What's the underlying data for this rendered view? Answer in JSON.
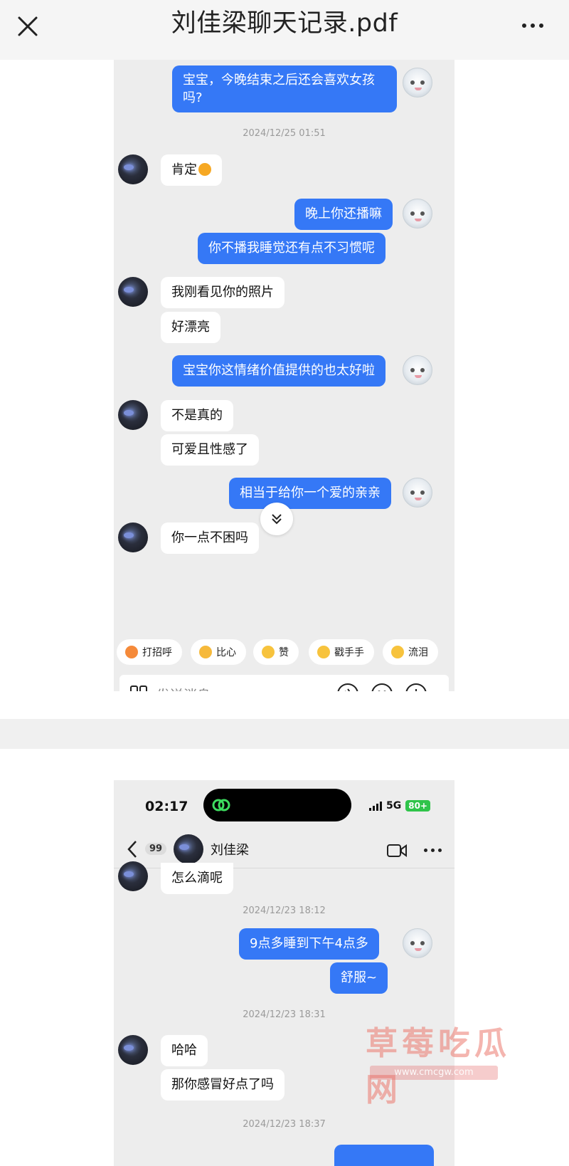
{
  "app": {
    "title": "刘佳梁聊天记录.pdf"
  },
  "page1": {
    "messages": [
      {
        "side": "out",
        "text": "宝宝，今晚结束之后还会喜欢女孩吗?"
      },
      {
        "side": "time",
        "text": "2024/12/25 01:51"
      },
      {
        "side": "in",
        "text": "肯定"
      },
      {
        "side": "out",
        "text": "晚上你还播嘛"
      },
      {
        "side": "out",
        "text": "你不播我睡觉还有点不习惯呢"
      },
      {
        "side": "in",
        "text": "我刚看见你的照片"
      },
      {
        "side": "in",
        "text": "好漂亮"
      },
      {
        "side": "out",
        "text": "宝宝你这情绪价值提供的也太好啦"
      },
      {
        "side": "in",
        "text": "不是真的"
      },
      {
        "side": "in",
        "text": "可爱且性感了"
      },
      {
        "side": "out",
        "text": "相当于给你一个爱的亲亲"
      },
      {
        "side": "in",
        "text": "你一点不困吗"
      }
    ],
    "quick_replies": [
      "打招呼",
      "比心",
      "赞",
      "戳手手",
      "流泪"
    ],
    "input_placeholder": "发送消息"
  },
  "page2": {
    "status_time": "02:17",
    "network": "5G",
    "battery": "80+",
    "unread_count": "99",
    "contact_name": "刘佳梁",
    "messages": [
      {
        "side": "in",
        "text": "怎么滴呢"
      },
      {
        "side": "time",
        "text": "2024/12/23 18:12"
      },
      {
        "side": "out",
        "text": "9点多睡到下午4点多"
      },
      {
        "side": "out",
        "text": "舒服~"
      },
      {
        "side": "time",
        "text": "2024/12/23 18:31"
      },
      {
        "side": "in",
        "text": "哈哈"
      },
      {
        "side": "in",
        "text": "那你感冒好点了吗"
      },
      {
        "side": "time",
        "text": "2024/12/23 18:37"
      }
    ]
  },
  "watermark": {
    "title": "草莓吃瓜网",
    "url": "www.cmcgw.com"
  },
  "colors": {
    "outgoing_bubble": "#3578f6",
    "incoming_bubble": "#ffffff",
    "chat_background": "#ededed"
  }
}
